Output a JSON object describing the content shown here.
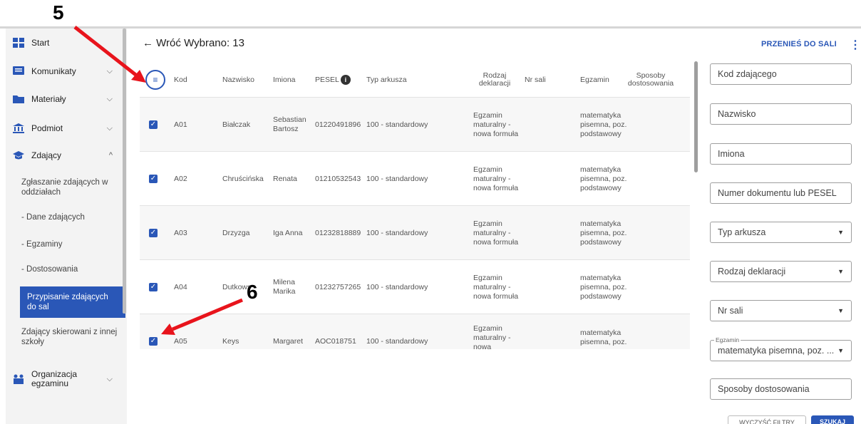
{
  "header": {
    "back_label": "← Wróć",
    "selected_label": "Wybrano: 13",
    "move_button": "PRZENIEŚ DO SALI"
  },
  "sidebar": {
    "items": [
      {
        "label": "Start",
        "icon": "dashboard-icon"
      },
      {
        "label": "Komunikaty",
        "icon": "message-icon"
      },
      {
        "label": "Materiały",
        "icon": "folder-icon"
      },
      {
        "label": "Podmiot",
        "icon": "institution-icon"
      },
      {
        "label": "Zdający",
        "icon": "graduation-cap-icon"
      }
    ],
    "subitems": [
      "Zgłaszanie zdających w oddziałach",
      "- Dane zdających",
      "- Egzaminy",
      "- Dostosowania",
      "Przypisanie zdających do sal",
      "Zdający skierowani z innej szkoły"
    ],
    "org_label": "Organizacja egzaminu"
  },
  "table": {
    "columns": [
      "Kod",
      "Nazwisko",
      "Imiona",
      "PESEL",
      "Typ arkusza",
      "Rodzaj deklaracji",
      "Nr sali",
      "Egzamin",
      "Sposoby dostosowania"
    ],
    "rows": [
      {
        "kod": "A01",
        "nazwisko": "Białczak",
        "imiona": "Sebastian Bartosz",
        "pesel": "01220491896",
        "typ": "100 - standardowy",
        "rodzaj": "Egzamin maturalny - nowa formuła",
        "egzamin": "matematyka pisemna, poz. podstawowy"
      },
      {
        "kod": "A02",
        "nazwisko": "Chruścińska",
        "imiona": "Renata",
        "pesel": "01210532543",
        "typ": "100 - standardowy",
        "rodzaj": "Egzamin maturalny - nowa formuła",
        "egzamin": "matematyka pisemna, poz. podstawowy"
      },
      {
        "kod": "A03",
        "nazwisko": "Drzyzga",
        "imiona": "Iga Anna",
        "pesel": "01232818889",
        "typ": "100 - standardowy",
        "rodzaj": "Egzamin maturalny - nowa formuła",
        "egzamin": "matematyka pisemna, poz. podstawowy"
      },
      {
        "kod": "A04",
        "nazwisko": "Dutkows",
        "imiona": "Milena Marika",
        "pesel": "01232757265",
        "typ": "100 - standardowy",
        "rodzaj": "Egzamin maturalny - nowa formuła",
        "egzamin": "matematyka pisemna, poz. podstawowy"
      },
      {
        "kod": "A05",
        "nazwisko": "Keys",
        "imiona": "Margaret",
        "pesel": "AOC018751",
        "typ": "100 - standardowy",
        "rodzaj": "Egzamin maturalny - nowa",
        "egzamin": "matematyka pisemna, poz."
      }
    ]
  },
  "filters": {
    "kod": "Kod zdającego",
    "nazwisko": "Nazwisko",
    "imiona": "Imiona",
    "pesel": "Numer dokumentu lub PESEL",
    "typ": "Typ arkusza",
    "rodzaj": "Rodzaj deklaracji",
    "nr_sali": "Nr sali",
    "egzamin_legend": "Egzamin",
    "egzamin_value": "matematyka pisemna, poz. ...",
    "sposoby": "Sposoby dostosowania",
    "clear_button": "WYCZYŚĆ FILTRY",
    "search_button": "SZUKAJ"
  },
  "annotations": {
    "step5": "5",
    "step6": "6"
  },
  "colors": {
    "accent": "#2a57b7",
    "arrow": "#e8141c"
  }
}
